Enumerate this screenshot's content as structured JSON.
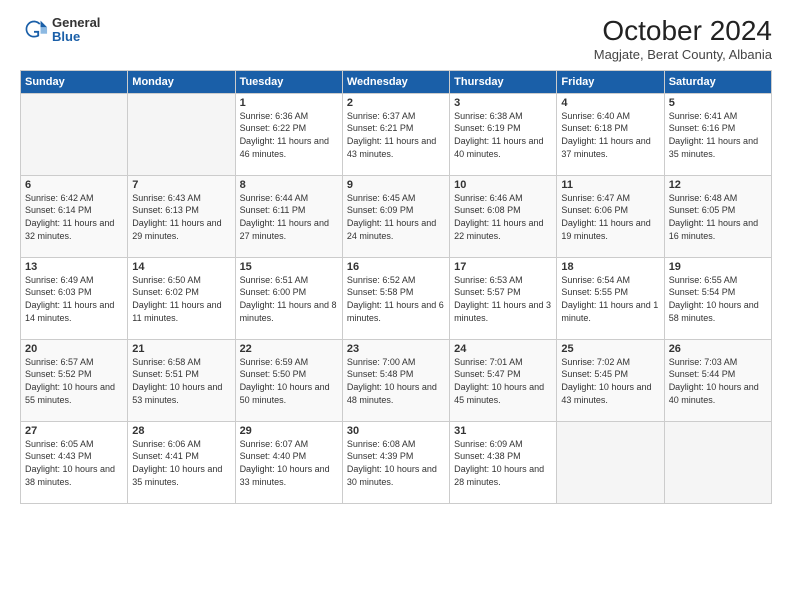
{
  "logo": {
    "general": "General",
    "blue": "Blue"
  },
  "header": {
    "month": "October 2024",
    "location": "Magjate, Berat County, Albania"
  },
  "weekdays": [
    "Sunday",
    "Monday",
    "Tuesday",
    "Wednesday",
    "Thursday",
    "Friday",
    "Saturday"
  ],
  "weeks": [
    [
      null,
      null,
      {
        "day": 1,
        "sunrise": "6:36 AM",
        "sunset": "6:22 PM",
        "daylight": "11 hours and 46 minutes."
      },
      {
        "day": 2,
        "sunrise": "6:37 AM",
        "sunset": "6:21 PM",
        "daylight": "11 hours and 43 minutes."
      },
      {
        "day": 3,
        "sunrise": "6:38 AM",
        "sunset": "6:19 PM",
        "daylight": "11 hours and 40 minutes."
      },
      {
        "day": 4,
        "sunrise": "6:40 AM",
        "sunset": "6:18 PM",
        "daylight": "11 hours and 37 minutes."
      },
      {
        "day": 5,
        "sunrise": "6:41 AM",
        "sunset": "6:16 PM",
        "daylight": "11 hours and 35 minutes."
      }
    ],
    [
      {
        "day": 6,
        "sunrise": "6:42 AM",
        "sunset": "6:14 PM",
        "daylight": "11 hours and 32 minutes."
      },
      {
        "day": 7,
        "sunrise": "6:43 AM",
        "sunset": "6:13 PM",
        "daylight": "11 hours and 29 minutes."
      },
      {
        "day": 8,
        "sunrise": "6:44 AM",
        "sunset": "6:11 PM",
        "daylight": "11 hours and 27 minutes."
      },
      {
        "day": 9,
        "sunrise": "6:45 AM",
        "sunset": "6:09 PM",
        "daylight": "11 hours and 24 minutes."
      },
      {
        "day": 10,
        "sunrise": "6:46 AM",
        "sunset": "6:08 PM",
        "daylight": "11 hours and 22 minutes."
      },
      {
        "day": 11,
        "sunrise": "6:47 AM",
        "sunset": "6:06 PM",
        "daylight": "11 hours and 19 minutes."
      },
      {
        "day": 12,
        "sunrise": "6:48 AM",
        "sunset": "6:05 PM",
        "daylight": "11 hours and 16 minutes."
      }
    ],
    [
      {
        "day": 13,
        "sunrise": "6:49 AM",
        "sunset": "6:03 PM",
        "daylight": "11 hours and 14 minutes."
      },
      {
        "day": 14,
        "sunrise": "6:50 AM",
        "sunset": "6:02 PM",
        "daylight": "11 hours and 11 minutes."
      },
      {
        "day": 15,
        "sunrise": "6:51 AM",
        "sunset": "6:00 PM",
        "daylight": "11 hours and 8 minutes."
      },
      {
        "day": 16,
        "sunrise": "6:52 AM",
        "sunset": "5:58 PM",
        "daylight": "11 hours and 6 minutes."
      },
      {
        "day": 17,
        "sunrise": "6:53 AM",
        "sunset": "5:57 PM",
        "daylight": "11 hours and 3 minutes."
      },
      {
        "day": 18,
        "sunrise": "6:54 AM",
        "sunset": "5:55 PM",
        "daylight": "11 hours and 1 minute."
      },
      {
        "day": 19,
        "sunrise": "6:55 AM",
        "sunset": "5:54 PM",
        "daylight": "10 hours and 58 minutes."
      }
    ],
    [
      {
        "day": 20,
        "sunrise": "6:57 AM",
        "sunset": "5:52 PM",
        "daylight": "10 hours and 55 minutes."
      },
      {
        "day": 21,
        "sunrise": "6:58 AM",
        "sunset": "5:51 PM",
        "daylight": "10 hours and 53 minutes."
      },
      {
        "day": 22,
        "sunrise": "6:59 AM",
        "sunset": "5:50 PM",
        "daylight": "10 hours and 50 minutes."
      },
      {
        "day": 23,
        "sunrise": "7:00 AM",
        "sunset": "5:48 PM",
        "daylight": "10 hours and 48 minutes."
      },
      {
        "day": 24,
        "sunrise": "7:01 AM",
        "sunset": "5:47 PM",
        "daylight": "10 hours and 45 minutes."
      },
      {
        "day": 25,
        "sunrise": "7:02 AM",
        "sunset": "5:45 PM",
        "daylight": "10 hours and 43 minutes."
      },
      {
        "day": 26,
        "sunrise": "7:03 AM",
        "sunset": "5:44 PM",
        "daylight": "10 hours and 40 minutes."
      }
    ],
    [
      {
        "day": 27,
        "sunrise": "6:05 AM",
        "sunset": "4:43 PM",
        "daylight": "10 hours and 38 minutes."
      },
      {
        "day": 28,
        "sunrise": "6:06 AM",
        "sunset": "4:41 PM",
        "daylight": "10 hours and 35 minutes."
      },
      {
        "day": 29,
        "sunrise": "6:07 AM",
        "sunset": "4:40 PM",
        "daylight": "10 hours and 33 minutes."
      },
      {
        "day": 30,
        "sunrise": "6:08 AM",
        "sunset": "4:39 PM",
        "daylight": "10 hours and 30 minutes."
      },
      {
        "day": 31,
        "sunrise": "6:09 AM",
        "sunset": "4:38 PM",
        "daylight": "10 hours and 28 minutes."
      },
      null,
      null
    ]
  ]
}
